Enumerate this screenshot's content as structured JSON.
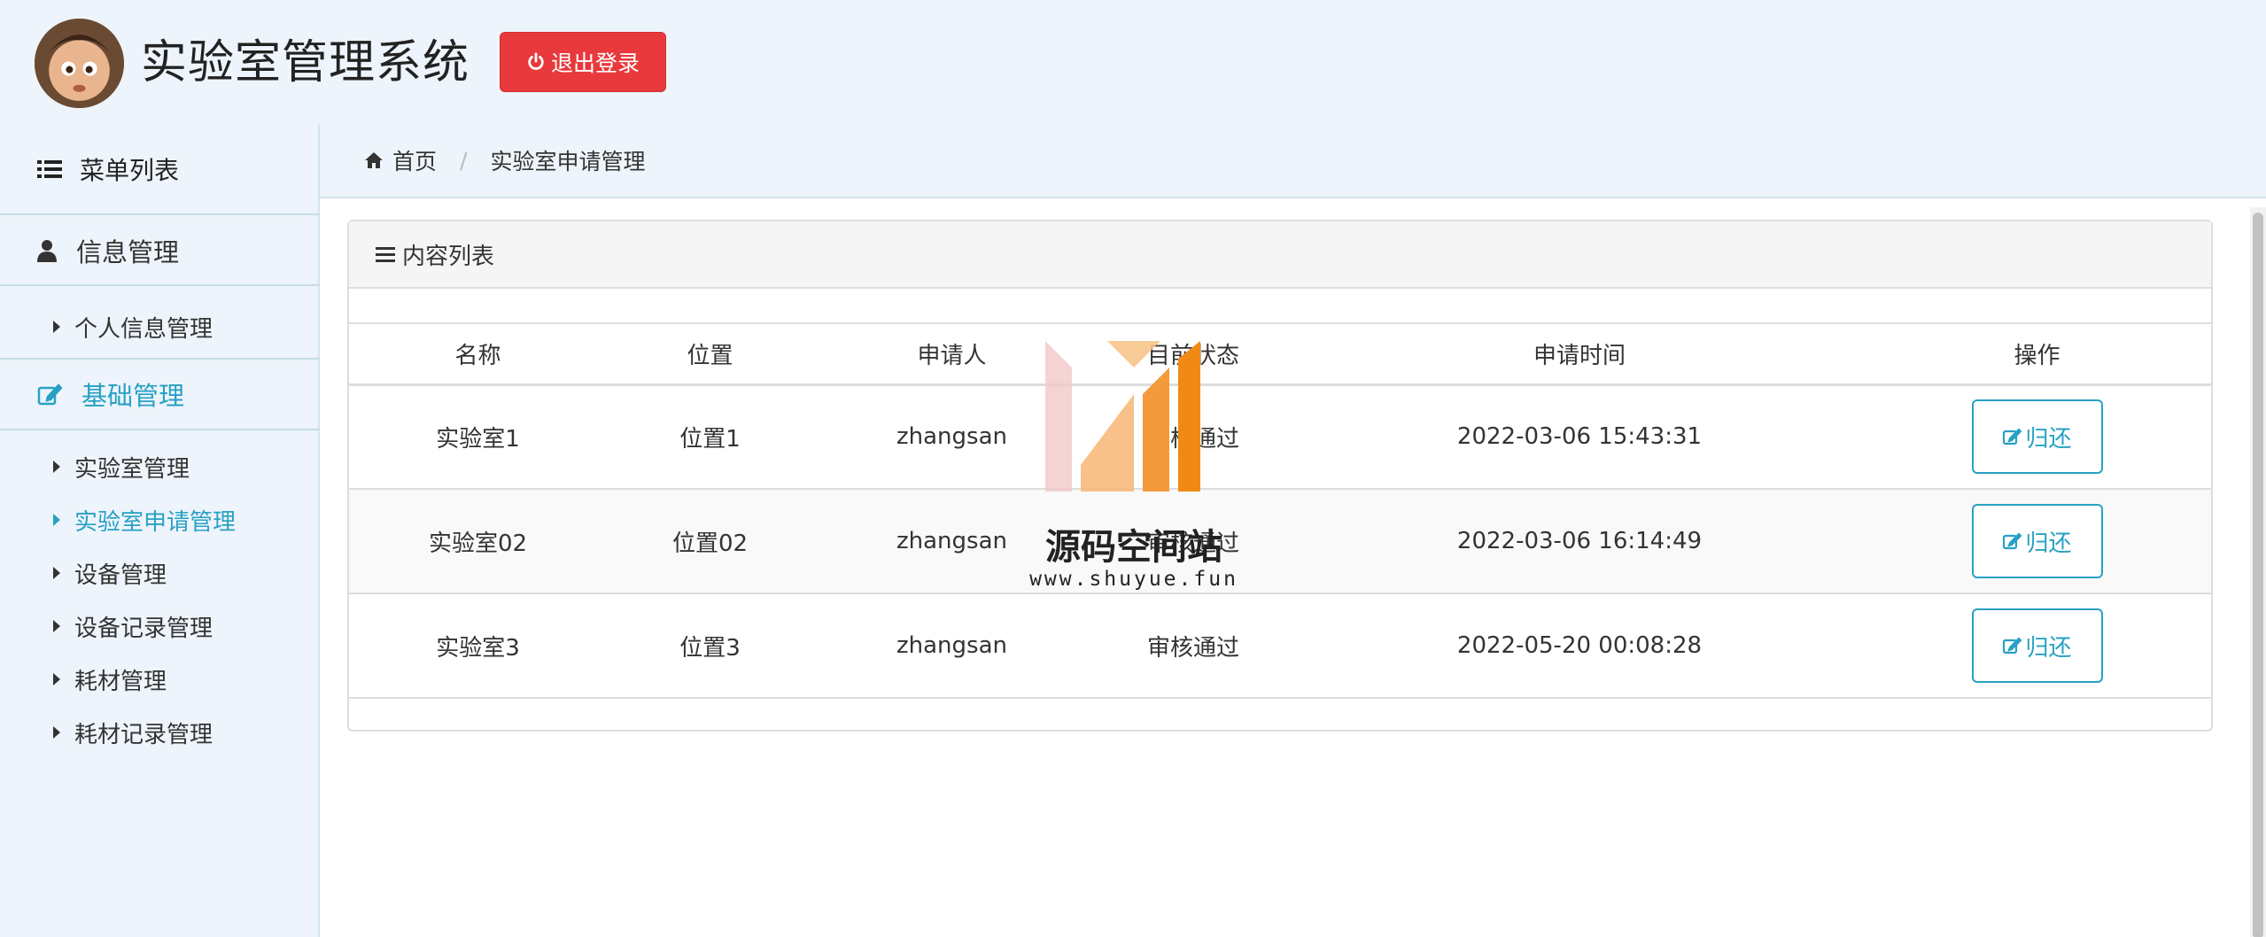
{
  "header": {
    "app_title": "实验室管理系统",
    "logout_label": "退出登录"
  },
  "sidebar": {
    "menu_title": "菜单列表",
    "sections": [
      {
        "label": "信息管理",
        "items": [
          {
            "label": "个人信息管理"
          }
        ]
      },
      {
        "label": "基础管理",
        "items": [
          {
            "label": "实验室管理"
          },
          {
            "label": "实验室申请管理",
            "active": true
          },
          {
            "label": "设备管理"
          },
          {
            "label": "设备记录管理"
          },
          {
            "label": "耗材管理"
          },
          {
            "label": "耗材记录管理"
          }
        ]
      }
    ]
  },
  "breadcrumb": {
    "home": "首页",
    "current": "实验室申请管理"
  },
  "panel": {
    "title": "内容列表"
  },
  "table": {
    "headers": [
      "名称",
      "位置",
      "申请人",
      "目前状态",
      "申请时间",
      "操作"
    ],
    "rows": [
      {
        "name": "实验室1",
        "position": "位置1",
        "applicant": "zhangsan",
        "status": "审核通过",
        "time": "2022-03-06 15:43:31",
        "action": "归还"
      },
      {
        "name": "实验室02",
        "position": "位置02",
        "applicant": "zhangsan",
        "status": "审核通过",
        "time": "2022-03-06 16:14:49",
        "action": "归还"
      },
      {
        "name": "实验室3",
        "position": "位置3",
        "applicant": "zhangsan",
        "status": "审核通过",
        "time": "2022-05-20 00:08:28",
        "action": "归还"
      }
    ]
  },
  "watermark": {
    "title": "源码空间站",
    "url": "www.shuyue.fun"
  },
  "colors": {
    "accent": "#27a1c4",
    "danger": "#e8393c",
    "background": "#eef4fb"
  }
}
